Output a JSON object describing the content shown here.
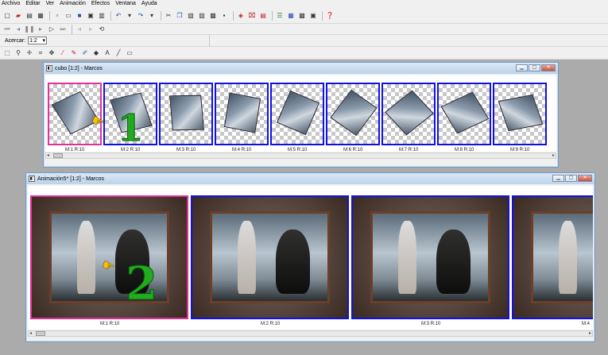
{
  "menu": [
    "Archivo",
    "Editar",
    "Ver",
    "Animación",
    "Efectos",
    "Ventana",
    "Ayuda"
  ],
  "toolbar": {
    "main_icons": [
      "new-icon",
      "open-icon",
      "save-icon",
      "save-as-icon",
      "print-icon",
      "cut-icon",
      "copy-icon",
      "paste-icon",
      "undo-icon",
      "redo-icon",
      "properties-icon",
      "insert-icon",
      "delete-icon",
      "help-icon"
    ],
    "zoom_label": "Acercar:",
    "zoom_value": "1:2"
  },
  "windows": [
    {
      "title": "cubo [1:2] - Marcos",
      "frames": [
        {
          "label": "M:1  R:10",
          "selected": true
        },
        {
          "label": "M:2  R:10",
          "selected": false
        },
        {
          "label": "M:3  R:10",
          "selected": false
        },
        {
          "label": "M:4  R:10",
          "selected": false
        },
        {
          "label": "M:5  R:10",
          "selected": false
        },
        {
          "label": "M:6  R:10",
          "selected": false
        },
        {
          "label": "M:7  R:10",
          "selected": false
        },
        {
          "label": "M:8  R:10",
          "selected": false
        },
        {
          "label": "M:9  R:10",
          "selected": false
        }
      ]
    },
    {
      "title": "Animación5* [1:2] - Marcos",
      "frames": [
        {
          "label": "M:1  R:10",
          "selected": true
        },
        {
          "label": "M:2  R:10",
          "selected": false
        },
        {
          "label": "M:3  R:10",
          "selected": false
        },
        {
          "label": "M:4",
          "selected": false
        }
      ]
    }
  ],
  "annotations": {
    "step1": "1",
    "step2": "2"
  },
  "colors": {
    "frame_border": "#1010e6",
    "selected_border": "#e0309c",
    "step_number": "#22aa22"
  }
}
